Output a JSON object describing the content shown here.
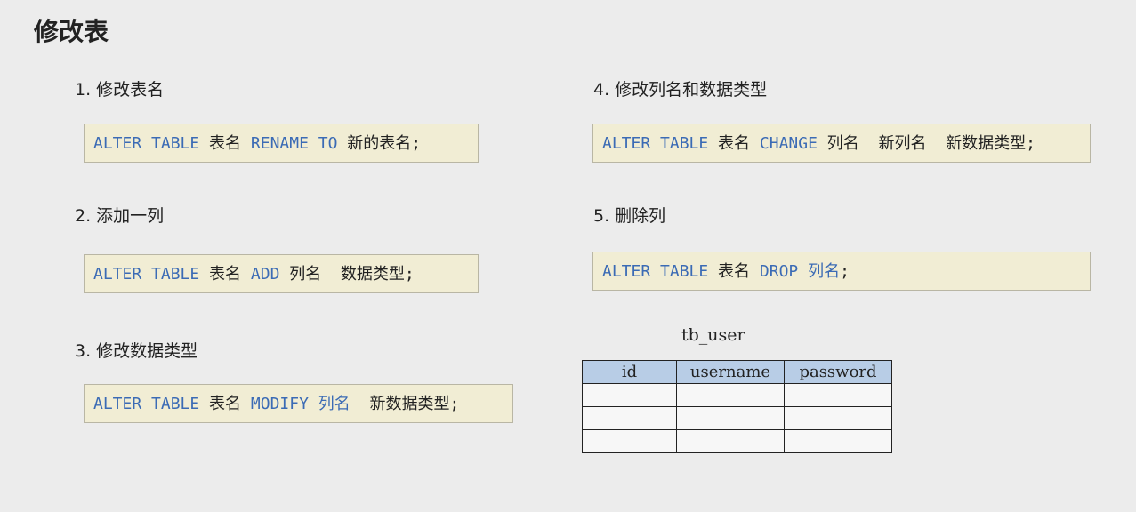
{
  "title": "修改表",
  "sections": [
    {
      "heading": "1. 修改表名",
      "parts": [
        {
          "t": "ALTER TABLE",
          "kw": true
        },
        {
          "t": " 表名 ",
          "kw": false
        },
        {
          "t": "RENAME TO",
          "kw": true
        },
        {
          "t": " 新的表名;",
          "kw": false
        }
      ]
    },
    {
      "heading": "2. 添加一列",
      "parts": [
        {
          "t": "ALTER TABLE",
          "kw": true
        },
        {
          "t": " 表名 ",
          "kw": false
        },
        {
          "t": "ADD",
          "kw": true
        },
        {
          "t": " 列名  数据类型;",
          "kw": false
        }
      ]
    },
    {
      "heading": "3. 修改数据类型",
      "parts": [
        {
          "t": "ALTER TABLE",
          "kw": true
        },
        {
          "t": " 表名 ",
          "kw": false
        },
        {
          "t": "MODIFY 列名",
          "kw": true
        },
        {
          "t": "  新数据类型;",
          "kw": false
        }
      ]
    },
    {
      "heading": "4. 修改列名和数据类型",
      "parts": [
        {
          "t": "ALTER TABLE",
          "kw": true
        },
        {
          "t": " 表名 ",
          "kw": false
        },
        {
          "t": "CHANGE",
          "kw": true
        },
        {
          "t": " 列名  新列名  新数据类型;",
          "kw": false
        }
      ]
    },
    {
      "heading": "5. 删除列",
      "parts": [
        {
          "t": "ALTER TABLE",
          "kw": true
        },
        {
          "t": " 表名 ",
          "kw": false
        },
        {
          "t": "DROP 列名",
          "kw": true
        },
        {
          "t": ";",
          "kw": false
        }
      ]
    }
  ],
  "table": {
    "name": "tb_user",
    "columns": [
      "id",
      "username",
      "password"
    ],
    "rows": [
      [
        "",
        "",
        ""
      ],
      [
        "",
        "",
        ""
      ],
      [
        "",
        "",
        ""
      ]
    ]
  },
  "colors": {
    "keyword": "#3b6bb5",
    "code_bg": "#f1edd4",
    "header_bg": "#b8cde6"
  }
}
